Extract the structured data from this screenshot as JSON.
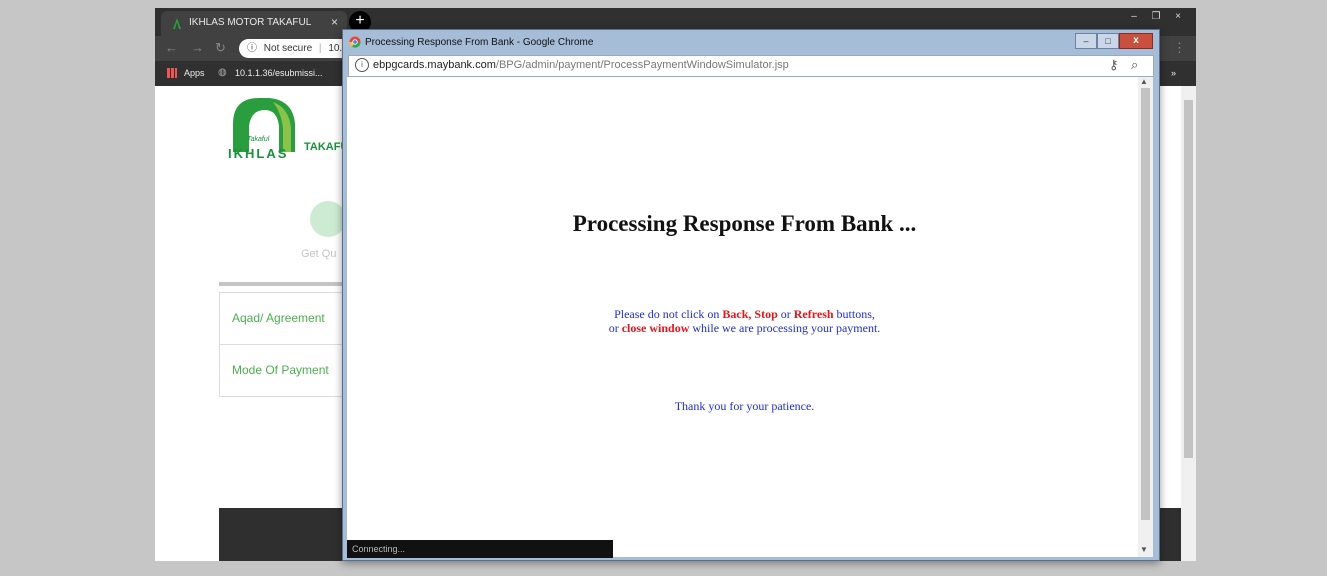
{
  "browser": {
    "tab_title": "IKHLAS MOTOR TAKAFUL",
    "tab_close": "×",
    "new_tab": "+",
    "window_controls": [
      "–",
      "❐",
      "×"
    ],
    "omnibox": {
      "security": "Not secure",
      "url_fragment": "10."
    },
    "bookmarks": {
      "apps": "Apps",
      "item1": "10.1.1.36/esubmissi...",
      "overflow": "»"
    }
  },
  "page": {
    "logo_small": "Takaful",
    "logo_text": "IKHLAS",
    "brand_text": "TAKAFU",
    "step_label": "Get Qu",
    "accordion": [
      "Aqad/ Agreement",
      "Mode Of Payment"
    ]
  },
  "popup": {
    "title": "Processing Response From Bank - Google Chrome",
    "minimize": "–",
    "maximize": "□",
    "close": "x",
    "url_host": "ebpgcards.maybank.com",
    "url_path": "/BPG/admin/payment/ProcessPaymentWindowSimulator.jsp",
    "heading": "Processing Response From Bank ...",
    "message": {
      "line1_a": "Please do not click on ",
      "back": "Back",
      "comma": ", ",
      "stop": "Stop",
      "or1": " or ",
      "refresh": "Refresh",
      "line1_b": " buttons,",
      "line2_a": "or ",
      "close_window": "close window",
      "line2_b": " while we are processing your payment."
    },
    "thanks": "Thank you for your patience.",
    "status": "Connecting..."
  },
  "colors": {
    "brand_green": "#1b8f3c",
    "accent_green": "#4caf50",
    "message_blue": "#1f2dd1",
    "warning_red": "#e3161b"
  }
}
